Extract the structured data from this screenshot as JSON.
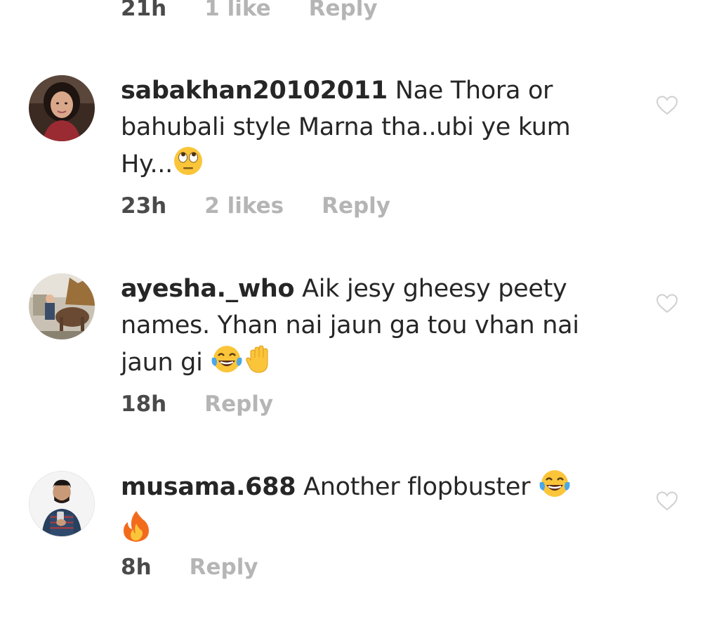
{
  "previous_comment": {
    "time": "21h",
    "likes": "1 like",
    "reply": "Reply"
  },
  "comments": [
    {
      "username": "sabakhan20102011",
      "text_lines": [
        "Nae Thora or",
        "bahubali style Marna tha..ubi ye kum",
        "Hy..."
      ],
      "emojis": [
        "face-with-rolling-eyes"
      ],
      "time": "23h",
      "likes": "2 likes",
      "reply": "Reply"
    },
    {
      "username": "ayesha._who",
      "text_lines": [
        "Aik jesy gheesy peety",
        "names. Yhan nai jaun ga tou vhan nai",
        "jaun gi"
      ],
      "emojis": [
        "face-with-tears-of-joy",
        "raised-hand"
      ],
      "time": "18h",
      "reply": "Reply"
    },
    {
      "username": "musama.688",
      "text_lines": [
        "Another flopbuster"
      ],
      "emojis": [
        "face-with-tears-of-joy",
        "fire"
      ],
      "time": "8h",
      "reply": "Reply"
    }
  ],
  "icons": {
    "like": "heart-outline-icon"
  },
  "colors": {
    "username": "#262626",
    "text": "#262626",
    "meta_time": "#4a4a4a",
    "meta_light": "#b5b5b5",
    "heart_outline": "#d0d0d0"
  }
}
